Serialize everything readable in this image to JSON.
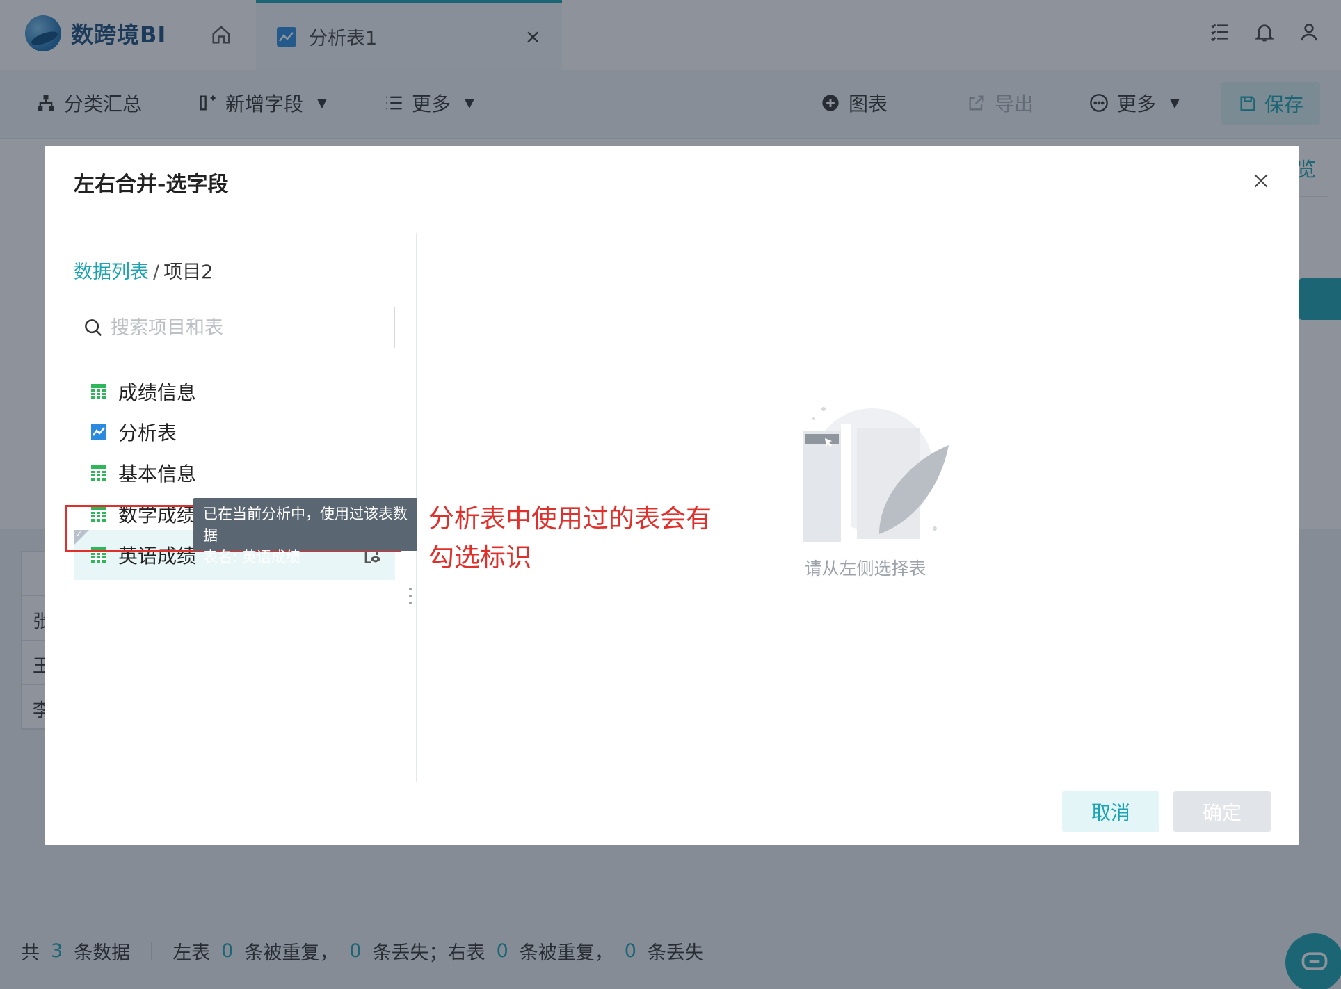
{
  "app": {
    "logo_text": "数跨境BI",
    "tab_label": "分析表1"
  },
  "toolbar": {
    "group_summary": "分类汇总",
    "add_field": "新增字段",
    "more_left": "更多",
    "chart": "图表",
    "export": "导出",
    "more_right": "更多",
    "save": "保存"
  },
  "background": {
    "preview_hint": "览",
    "table_rows": [
      "张",
      "王",
      "李"
    ]
  },
  "statusbar": {
    "total_prefix": "共",
    "total_count": "3",
    "total_suffix": "条数据",
    "left_prefix": "左表",
    "left_dup": "0",
    "dup_suffix": "条被重复，",
    "left_lost": "0",
    "left_lost_suffix": "条丢失；右表",
    "right_dup": "0",
    "right_dup_suffix": "条被重复，",
    "right_lost": "0",
    "lost_suffix": "条丢失"
  },
  "modal": {
    "title": "左右合并-选字段",
    "breadcrumb_link": "数据列表",
    "breadcrumb_separator": "/",
    "breadcrumb_current": "项目2",
    "search_placeholder": "搜索项目和表",
    "items": [
      {
        "label": "成绩信息",
        "icon": "table-icon"
      },
      {
        "label": "分析表",
        "icon": "analysis-icon"
      },
      {
        "label": "基本信息",
        "icon": "table-icon"
      },
      {
        "label": "数学成绩",
        "icon": "table-icon"
      },
      {
        "label": "英语成绩",
        "icon": "table-icon",
        "used": true
      }
    ],
    "tooltip_line1": "已在当前分析中，使用过该表数据",
    "tooltip_line2": "表名: 英语成绩",
    "annotation_line1": "分析表中使用过的表会有",
    "annotation_line2": "勾选标识",
    "empty_text": "请从左侧选择表",
    "cancel_label": "取消",
    "ok_label": "确定"
  },
  "colors": {
    "accent": "#1aa3b3",
    "annotation_red": "#e0302b",
    "table_icon_green": "#2fb55a",
    "analysis_icon_blue": "#2a8ae0"
  }
}
